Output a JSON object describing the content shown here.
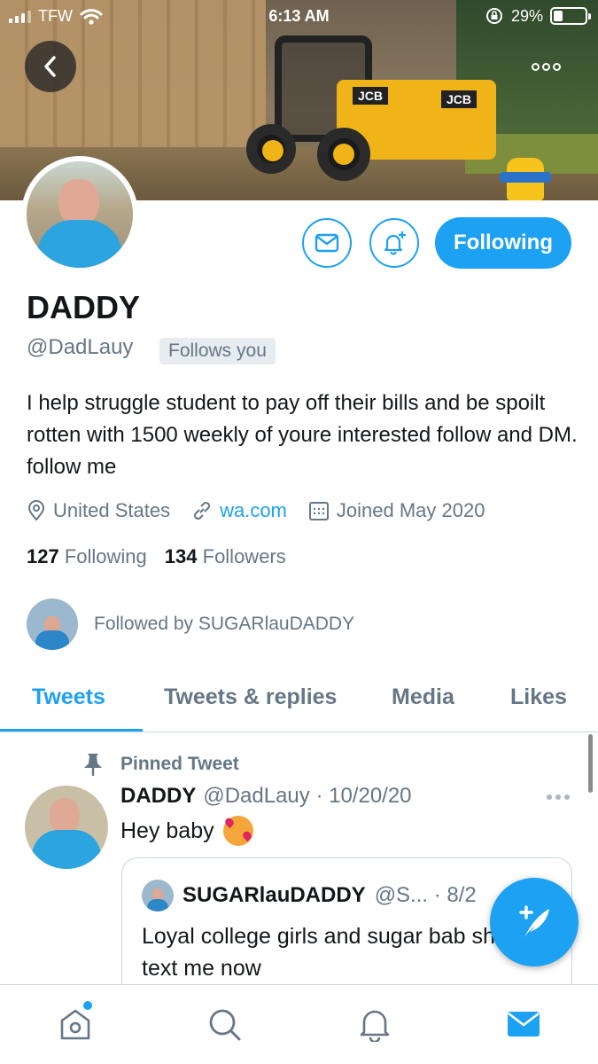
{
  "status_bar": {
    "carrier": "TFW",
    "time": "6:13 AM",
    "battery": "29%",
    "battery_level": 0.29
  },
  "profile": {
    "name": "DADDY",
    "handle": "@DadLauy",
    "follows_you": "Follows you",
    "bio": "I help struggle student to pay off their bills and be spoilt rotten with 1500 weekly of youre interested follow and DM. follow me",
    "location": "United States",
    "website": "wa.com",
    "joined": "Joined May 2020",
    "following_count": "127",
    "following_label": "Following",
    "followers_count": "134",
    "followers_label": "Followers",
    "followed_by": "Followed by SUGARlauDADDY",
    "follow_button": "Following"
  },
  "tabs": [
    {
      "label": "Tweets"
    },
    {
      "label": "Tweets & replies"
    },
    {
      "label": "Media"
    },
    {
      "label": "Likes"
    }
  ],
  "pinned_tweet": {
    "pinned_label": "Pinned Tweet",
    "name": "DADDY",
    "handle_date": "@DadLauy · 10/20/20",
    "text": "Hey baby",
    "emoji": "smiling-face-with-hearts",
    "quote": {
      "name": "SUGARlauDADDY",
      "handle_date": "@S... · 8/2",
      "text": "Loyal college girls and sugar bab should text me now"
    }
  },
  "colors": {
    "accent": "#1da1f2",
    "secondary_text": "#657786",
    "primary_text": "#14171a"
  },
  "icons": {
    "back": "chevron-left-icon",
    "more": "more-icon",
    "message": "mail-icon",
    "notifications": "bell-plus-icon",
    "location": "location-pin-icon",
    "link": "link-icon",
    "calendar": "calendar-icon",
    "pin": "pin-icon",
    "compose": "compose-tweet-icon",
    "nav": [
      "home-icon",
      "search-icon",
      "notifications-icon",
      "messages-icon"
    ]
  }
}
